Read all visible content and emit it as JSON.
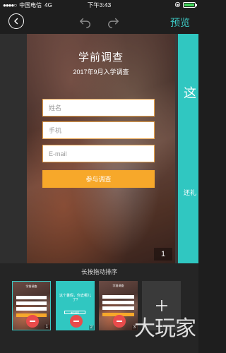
{
  "status_bar": {
    "signal": "●●●●○",
    "carrier": "中国电信",
    "network": "4G",
    "time": "下午3:43",
    "battery_level": 0.85,
    "battery_color": "#43d35b"
  },
  "toolbar": {
    "back_icon": "chevron-left-icon",
    "undo_icon": "undo-icon",
    "redo_icon": "redo-icon",
    "preview_label": "预览",
    "accent_color": "#3cc8c3"
  },
  "editor": {
    "page": {
      "title": "学前调查",
      "subtitle": "2017年9月入学调查",
      "fields": [
        {
          "placeholder": "姓名"
        },
        {
          "placeholder": "手机"
        },
        {
          "placeholder": "E-mail"
        }
      ],
      "submit_label": "参与调查",
      "page_number": "1"
    },
    "next_page": {
      "title_partial": "这",
      "subtitle_partial": "还礼"
    }
  },
  "bottom_panel": {
    "hint": "长按拖动排序",
    "thumbnails": [
      {
        "number": "1",
        "mini_title": "学前调查"
      },
      {
        "number": "2",
        "mini_title": "这个暑假，你去哪儿了?",
        "mini_button": "参与调查"
      },
      {
        "number": "3",
        "mini_title": "学前调查"
      }
    ],
    "add_label": "+",
    "watermark": "大玩家"
  }
}
